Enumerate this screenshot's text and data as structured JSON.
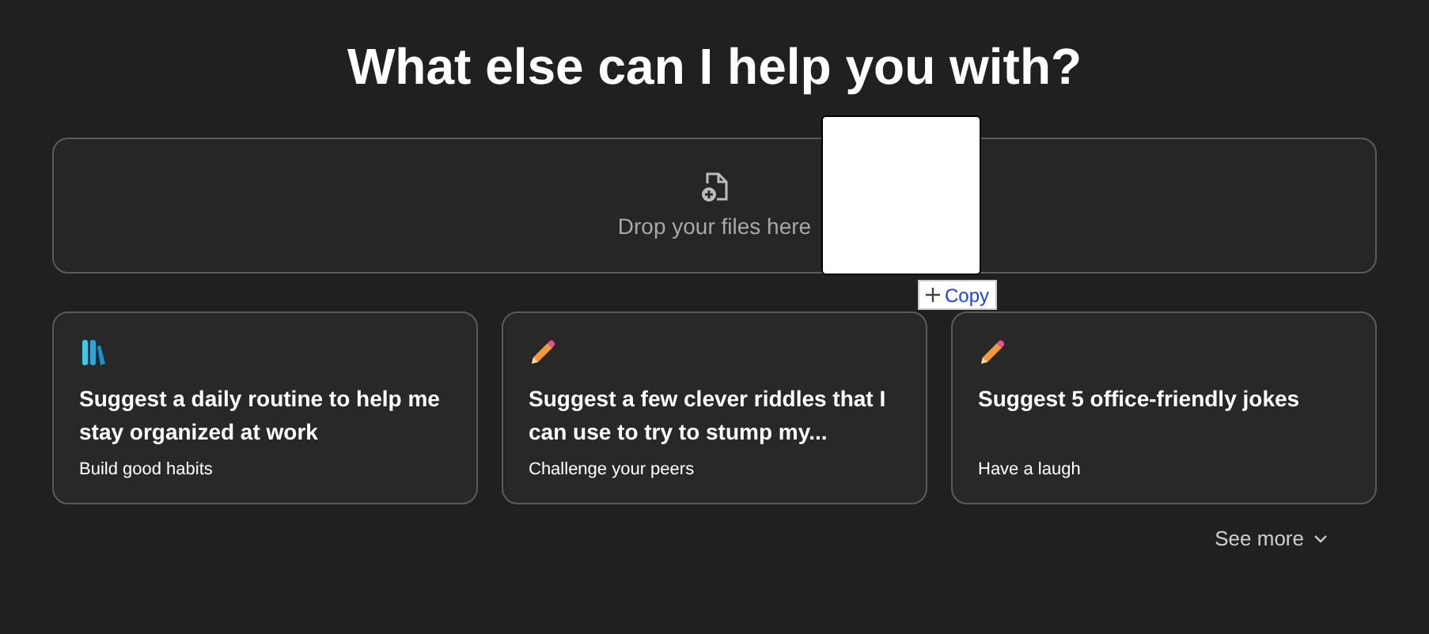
{
  "title": "What else can I help you with?",
  "dropzone": {
    "label": "Drop your files here"
  },
  "drag_preview": {
    "copy_label": "Copy"
  },
  "cards": [
    {
      "kind": "books",
      "title": "Suggest a daily routine to help me stay organized at work",
      "subtitle": "Build good habits"
    },
    {
      "kind": "pencil",
      "title": "Suggest a few clever riddles that I can use to try to stump my...",
      "subtitle": "Challenge your peers"
    },
    {
      "kind": "pencil",
      "title": "Suggest 5 office-friendly jokes",
      "subtitle": "Have a laugh"
    }
  ],
  "see_more": "See more"
}
